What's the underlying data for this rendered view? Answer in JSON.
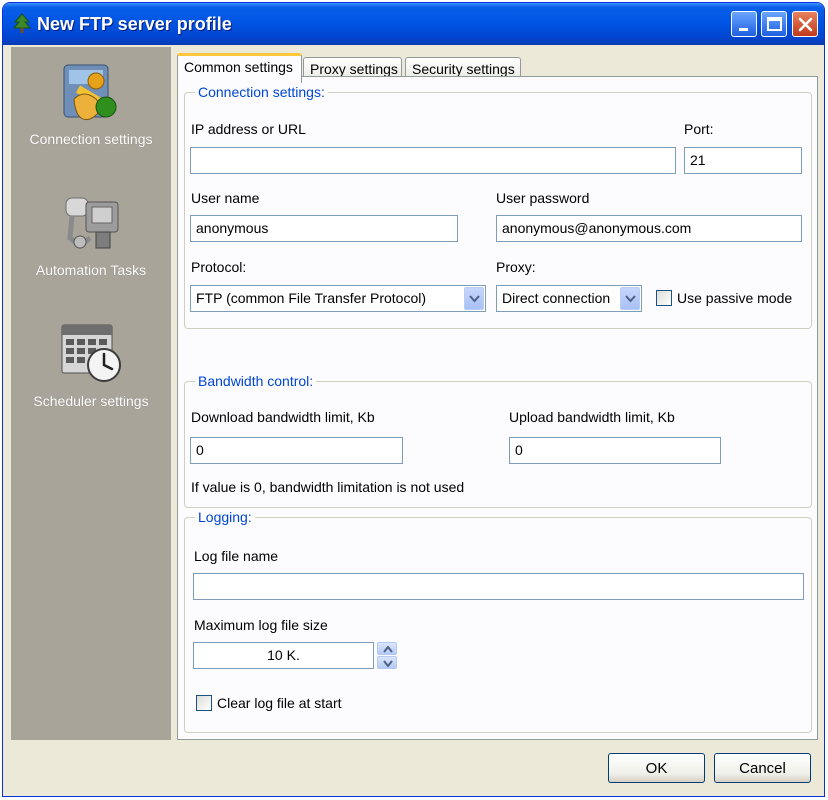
{
  "window": {
    "title": "New FTP server profile",
    "icon": "tree-app-icon"
  },
  "sidebar": {
    "items": [
      {
        "label": "Connection settings",
        "icon": "connection-settings-icon"
      },
      {
        "label": "Automation Tasks",
        "icon": "robot-icon"
      },
      {
        "label": "Scheduler settings",
        "icon": "calendar-clock-icon"
      }
    ]
  },
  "tabs": [
    {
      "label": "Common settings",
      "active": true
    },
    {
      "label": "Proxy settings",
      "active": false
    },
    {
      "label": "Security settings",
      "active": false
    }
  ],
  "connection": {
    "group_title": "Connection settings:",
    "ip_label": "IP address or URL",
    "ip_value": "",
    "port_label": "Port:",
    "port_value": "21",
    "user_label": "User name",
    "user_value": "anonymous",
    "password_label": "User password",
    "password_value": "anonymous@anonymous.com",
    "protocol_label": "Protocol:",
    "protocol_value": "FTP (common File Transfer Protocol)",
    "proxy_label": "Proxy:",
    "proxy_value": "Direct connection",
    "passive_label": "Use passive mode",
    "passive_checked": false
  },
  "bandwidth": {
    "group_title": "Bandwidth control:",
    "download_label": "Download bandwidth limit, Kb",
    "download_value": "0",
    "upload_label": "Upload bandwidth limit, Kb",
    "upload_value": "0",
    "note": "If value is 0, bandwidth limitation is not used"
  },
  "logging": {
    "group_title": "Logging:",
    "logfile_label": "Log file name",
    "logfile_value": "",
    "maxsize_label": "Maximum log file size",
    "maxsize_value": "10 K.",
    "clear_label": "Clear log file at start",
    "clear_checked": false
  },
  "footer": {
    "ok_label": "OK",
    "cancel_label": "Cancel"
  },
  "colors": {
    "titlebar": "#0055e5",
    "group_title": "#0046d5",
    "sidebar": "#a9a49a",
    "dialog": "#ece9d8"
  }
}
